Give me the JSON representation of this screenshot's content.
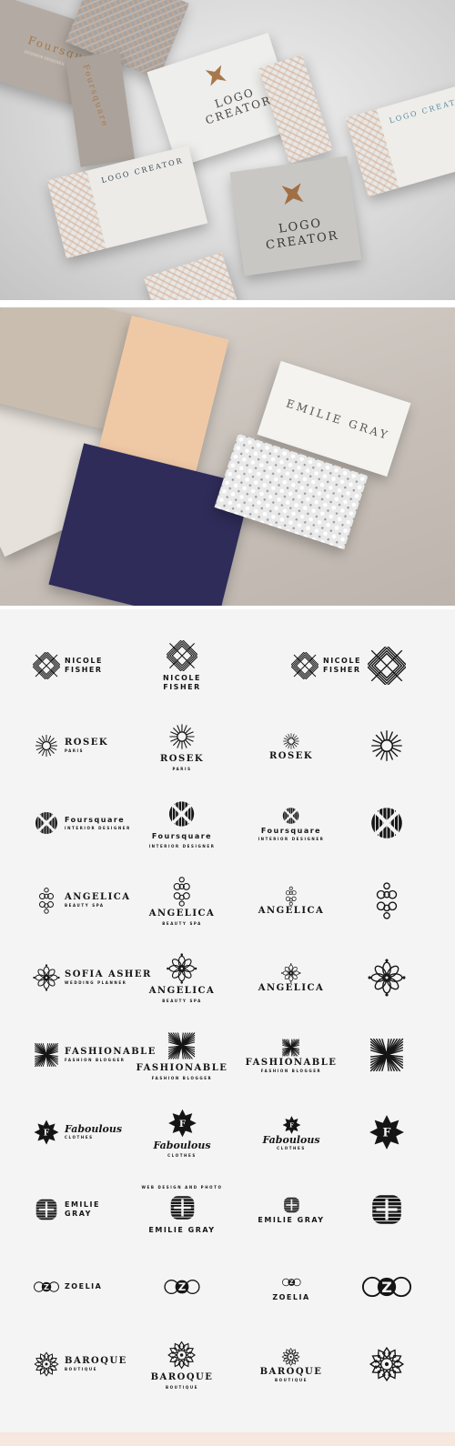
{
  "photo1": {
    "cards": {
      "foursquare_title": "Foursquare",
      "foursquare_sub": "INTERIOR DESIGNER",
      "vertical_title": "Foursquare",
      "logo_creator_a": "LOGO\nCREATOR",
      "logo_creator_b": "LOGO CREATOR",
      "logo_creator_c": "LOGO\nCREATOR",
      "logo_creator_d": "LOGO CREATOR"
    },
    "colors": {
      "gold": "#a8774a",
      "blue": "#5a8aa0",
      "background": "#d6d6d6"
    }
  },
  "photo2": {
    "card_title": "EMILIE GRAY",
    "colors": {
      "kraft": "#c9bdb0",
      "peach": "#efc9a6",
      "navy": "#2f2c5a",
      "cream": "#e6e1da"
    }
  },
  "logo_grid": {
    "rows": [
      {
        "cells": [
          {
            "layout": "h",
            "icon": "starburst",
            "title": "NICOLE\nFISHER",
            "subtitle": ""
          },
          {
            "layout": "v",
            "icon": "starburst",
            "title": "NICOLE\nFISHER",
            "subtitle": ""
          },
          {
            "layout": "h",
            "icon": "starburst-chain",
            "title": "NICOLE\nFISHER",
            "subtitle": ""
          },
          {
            "layout": "i",
            "icon": "starburst"
          }
        ]
      },
      {
        "style": "serif",
        "cells": [
          {
            "layout": "h",
            "icon": "rosette",
            "title": "ROSEK",
            "subtitle": "PARIS"
          },
          {
            "layout": "v",
            "icon": "rosette",
            "title": "ROSEK",
            "subtitle": "PARIS"
          },
          {
            "layout": "c",
            "icon": "rosette",
            "title": "ROSEK",
            "subtitle": ""
          },
          {
            "layout": "i",
            "icon": "rosette"
          }
        ]
      },
      {
        "cells": [
          {
            "layout": "h",
            "icon": "circle-x",
            "title": "Foursquare",
            "subtitle": "INTERIOR DESIGNER"
          },
          {
            "layout": "v",
            "icon": "circle-x",
            "title": "Foursquare",
            "subtitle": "INTERIOR DESIGNER"
          },
          {
            "layout": "c",
            "icon": "circle-x",
            "title": "Foursquare",
            "subtitle": "INTERIOR DESIGNER"
          },
          {
            "layout": "i",
            "icon": "circle-x"
          }
        ]
      },
      {
        "style": "serif",
        "cells": [
          {
            "layout": "h",
            "icon": "drop-chain",
            "title": "ANGELICA",
            "subtitle": "BEAUTY SPA"
          },
          {
            "layout": "v",
            "icon": "drop-chain",
            "title": "ANGELICA",
            "subtitle": "BEAUTY SPA"
          },
          {
            "layout": "c",
            "icon": "ribbon",
            "title": "ANGELICA",
            "subtitle": ""
          },
          {
            "layout": "i",
            "icon": "drop-chain"
          }
        ]
      },
      {
        "style": "serif",
        "cells": [
          {
            "layout": "h",
            "icon": "mandala",
            "title": "SOFIA ASHER",
            "subtitle": "WEDDING PLANNER"
          },
          {
            "layout": "v",
            "icon": "mandala",
            "title": "ANGELICA",
            "subtitle": "BEAUTY SPA"
          },
          {
            "layout": "c",
            "icon": "flower-cross",
            "title": "ANGELICA",
            "subtitle": ""
          },
          {
            "layout": "i",
            "icon": "mandala"
          }
        ]
      },
      {
        "style": "serif",
        "cells": [
          {
            "layout": "h",
            "icon": "square-pattern",
            "title": "FASHIONABLE",
            "subtitle": "FASHION BLOGGER"
          },
          {
            "layout": "v",
            "icon": "square-pattern",
            "title": "FASHIONABLE",
            "subtitle": "FASHION BLOGGER"
          },
          {
            "layout": "c",
            "icon": "square-pattern",
            "title": "FASHIONABLE",
            "subtitle": "FASHION BLOGGER"
          },
          {
            "layout": "i",
            "icon": "square-pattern"
          }
        ]
      },
      {
        "style": "script",
        "cells": [
          {
            "layout": "h",
            "icon": "flower-f",
            "title": "Faboulous",
            "subtitle": "CLOTHES"
          },
          {
            "layout": "v",
            "icon": "flower-f",
            "title": "Faboulous",
            "subtitle": "CLOTHES"
          },
          {
            "layout": "c",
            "icon": "flower-f",
            "title": "Faboulous",
            "subtitle": "CLOTHES"
          },
          {
            "layout": "i",
            "icon": "flower-f"
          }
        ]
      },
      {
        "cells": [
          {
            "layout": "h",
            "icon": "emblem",
            "title": "EMILIE\nGRAY",
            "subtitle": ""
          },
          {
            "layout": "v",
            "icon": "emblem",
            "title": "EMILIE GRAY",
            "subtitle": "",
            "arc_text": "WEB DESIGN AND PHOTO"
          },
          {
            "layout": "c",
            "icon": "emblem",
            "title": "EMILIE GRAY",
            "subtitle": ""
          },
          {
            "layout": "i",
            "icon": "emblem"
          }
        ]
      },
      {
        "cells": [
          {
            "layout": "h",
            "icon": "z-knot",
            "title": "ZOELIA",
            "subtitle": ""
          },
          {
            "layout": "i",
            "icon": "z-knot"
          },
          {
            "layout": "c",
            "icon": "z-knot",
            "title": "ZOELIA",
            "subtitle": ""
          },
          {
            "layout": "i",
            "icon": "z-knot-large"
          }
        ]
      },
      {
        "style": "serif",
        "cells": [
          {
            "layout": "h",
            "icon": "baroque",
            "title": "BAROQUE",
            "subtitle": "BOUTIQUE"
          },
          {
            "layout": "v",
            "icon": "baroque",
            "title": "BAROQUE",
            "subtitle": "BOUTIQUE"
          },
          {
            "layout": "c",
            "icon": "baroque",
            "title": "BAROQUE",
            "subtitle": "BOUTIQUE"
          },
          {
            "layout": "i",
            "icon": "baroque"
          }
        ]
      }
    ]
  }
}
